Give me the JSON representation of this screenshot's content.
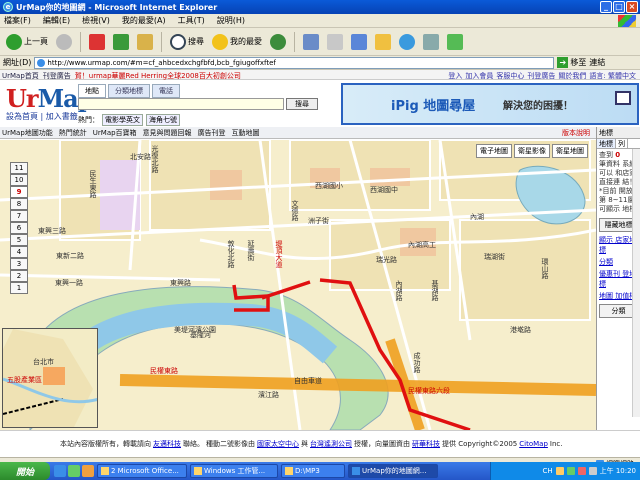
{
  "window": {
    "title": "UrMap你的地圖網 - Microsoft Internet Explorer"
  },
  "menu": [
    "檔案(F)",
    "編輯(E)",
    "檢視(V)",
    "我的最愛(A)",
    "工具(T)",
    "說明(H)"
  ],
  "toolbar": {
    "back": "上一頁",
    "search": "搜尋",
    "favorites": "我的最愛"
  },
  "address": {
    "label": "網址(D)",
    "url": "http://www.urmap.com/#m=cf_ahbcedxchgfbfd,bcb_fgiugoffxftef",
    "go": "移至",
    "links": "連結"
  },
  "site_nav": {
    "left": [
      "UrMap首頁",
      "刊登廣告",
      "賀！urmap華麗Red Herring全球2008百大初創公司"
    ],
    "right": [
      "登入",
      "加入會員",
      "客服中心",
      "刊登廣告",
      "關於我們",
      "語言: 繁體中文"
    ]
  },
  "logo": {
    "ur": "Ur",
    "map": "Map",
    "sub": "設為首頁 | 加入書籤"
  },
  "search": {
    "tabs": [
      "地點",
      "分類地標",
      "電話"
    ],
    "button": "搜尋",
    "hot_label": "熱門：",
    "hot_tags": [
      "電影學英文",
      "海角七號"
    ]
  },
  "banner": {
    "title": "iPig 地圖尋屋",
    "subtitle": "解決您的困擾！"
  },
  "map_toolbar": {
    "items": [
      "UrMap地圖功能",
      "熱門統計",
      "UrMap百寶箱",
      "意見與問題回報",
      "廣告刊登",
      "互動地圖"
    ],
    "right": "版本說明"
  },
  "map_types": [
    "電子地圖",
    "衛星影像",
    "衛星地圖"
  ],
  "zoom": {
    "levels": [
      "11",
      "10",
      "9",
      "8",
      "7",
      "6",
      "5",
      "4",
      "3",
      "2",
      "1"
    ],
    "current": "9"
  },
  "map_labels": {
    "vertical": [
      "光復北路",
      "延壽街",
      "民生東路",
      "敦化北路",
      "堤頂大道",
      "內湖路",
      "文德路",
      "成功路",
      "基湖路",
      "環山路"
    ],
    "horizontal": [
      "東興三路",
      "東新二路",
      "東興一路",
      "東興路",
      "西湖國小",
      "西湖國中",
      "內湖高工",
      "洲子街",
      "瑞光路",
      "內湖",
      "民權東路",
      "自由車道",
      "濱江路",
      "基隆河",
      "美堤河濱公園",
      "瑞湖街",
      "港墘路",
      "北安路",
      "民權東路六段"
    ]
  },
  "minimap": {
    "city": "台北市",
    "area": "五股產業區"
  },
  "right_panel": {
    "header": "地標",
    "tabs": [
      "地標",
      "列"
    ],
    "text_top": "查到",
    "red_count": "0",
    "text_body": "筆資料 系統可以 和店家 直接連 結！",
    "note": "*目前 開放第 8~11層 可顯示 地標",
    "btn": "隱藏地標",
    "link1": "顯示 店家地標",
    "link2": "分類",
    "link3": "優惠刊 登地標",
    "link4": "地圖 加值權",
    "link5": "分類"
  },
  "footer": {
    "text1": "本站內容版權所有，轉載請向",
    "link1": "友邁科技",
    "text2": "聯絡。",
    "text3": "種動二號影像由",
    "link2": "國家太空中心",
    "text4": "與",
    "link3": "台灣遙測公司",
    "text5": "授權，向量圖資由",
    "link4": "研華科技",
    "text6": "提供 Copyright©2005",
    "link5": "CitoMap",
    "text7": "Inc."
  },
  "statusbar": {
    "zone": "網際網路"
  },
  "taskbar": {
    "start": "開始",
    "tasks": [
      "2 Microsoft Office...",
      "Windows 工作管...",
      "D:\\MP3",
      "UrMap你的地圖網..."
    ],
    "lang": "CH",
    "clock": "上午 10:20"
  },
  "colors": {
    "route": "#e01010",
    "highway": "#f0a020",
    "river": "#a8d8a0",
    "park": "#d8e8c8"
  }
}
